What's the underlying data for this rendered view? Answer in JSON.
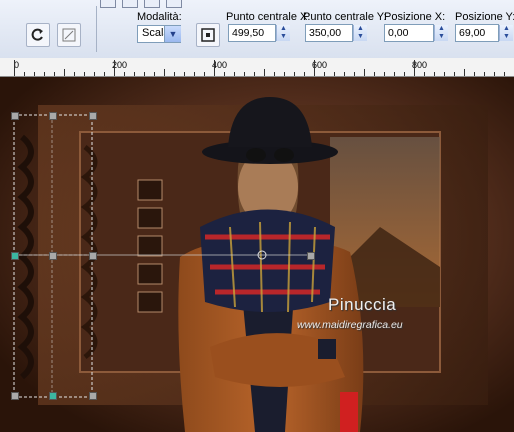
{
  "toolbar": {
    "mode_label": "Modalità:",
    "mode_value": "Scala",
    "center_x_label": "Punto centrale X:",
    "center_x_value": "499,50",
    "center_y_label": "Punto centrale Y:",
    "center_y_value": "350,00",
    "pos_x_label": "Posizione X:",
    "pos_x_value": "0,00",
    "pos_y_label": "Posizione Y:",
    "pos_y_value": "69,00"
  },
  "ruler": {
    "labels": [
      "0",
      "200",
      "400",
      "600",
      "800"
    ]
  },
  "canvas": {
    "watermark_name": "Pinuccia",
    "watermark_url": "www.maidiregrafica.eu"
  },
  "colors": {
    "toolbar_bg": "#dde4f1",
    "canvas_bg": "#3d1f10",
    "accent": "#2a4d9a"
  }
}
